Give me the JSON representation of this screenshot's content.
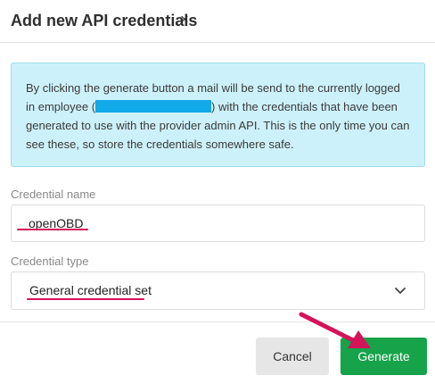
{
  "dialog": {
    "title": "Add new API credentials",
    "close_glyph": "×"
  },
  "info": {
    "text_before": "By clicking the generate button a mail will be send to the currently logged in employee (",
    "text_after": ") with the credentials that have been generated to use with the provider admin API. This is the only time you can see these, so store the credentials somewhere safe."
  },
  "form": {
    "name_label": "Credential name",
    "name_value": "openOBD",
    "type_label": "Credential type",
    "type_value": "General credential set"
  },
  "buttons": {
    "cancel": "Cancel",
    "generate": "Generate"
  },
  "colors": {
    "generate": "#16a34a",
    "annotation": "#d4145a",
    "info_bg": "#cdf1fb",
    "redaction": "#12a9e8"
  },
  "icons": {
    "close": "close-icon",
    "dropdown": "chevron-down-icon",
    "annotation": "arrow-annotation"
  }
}
